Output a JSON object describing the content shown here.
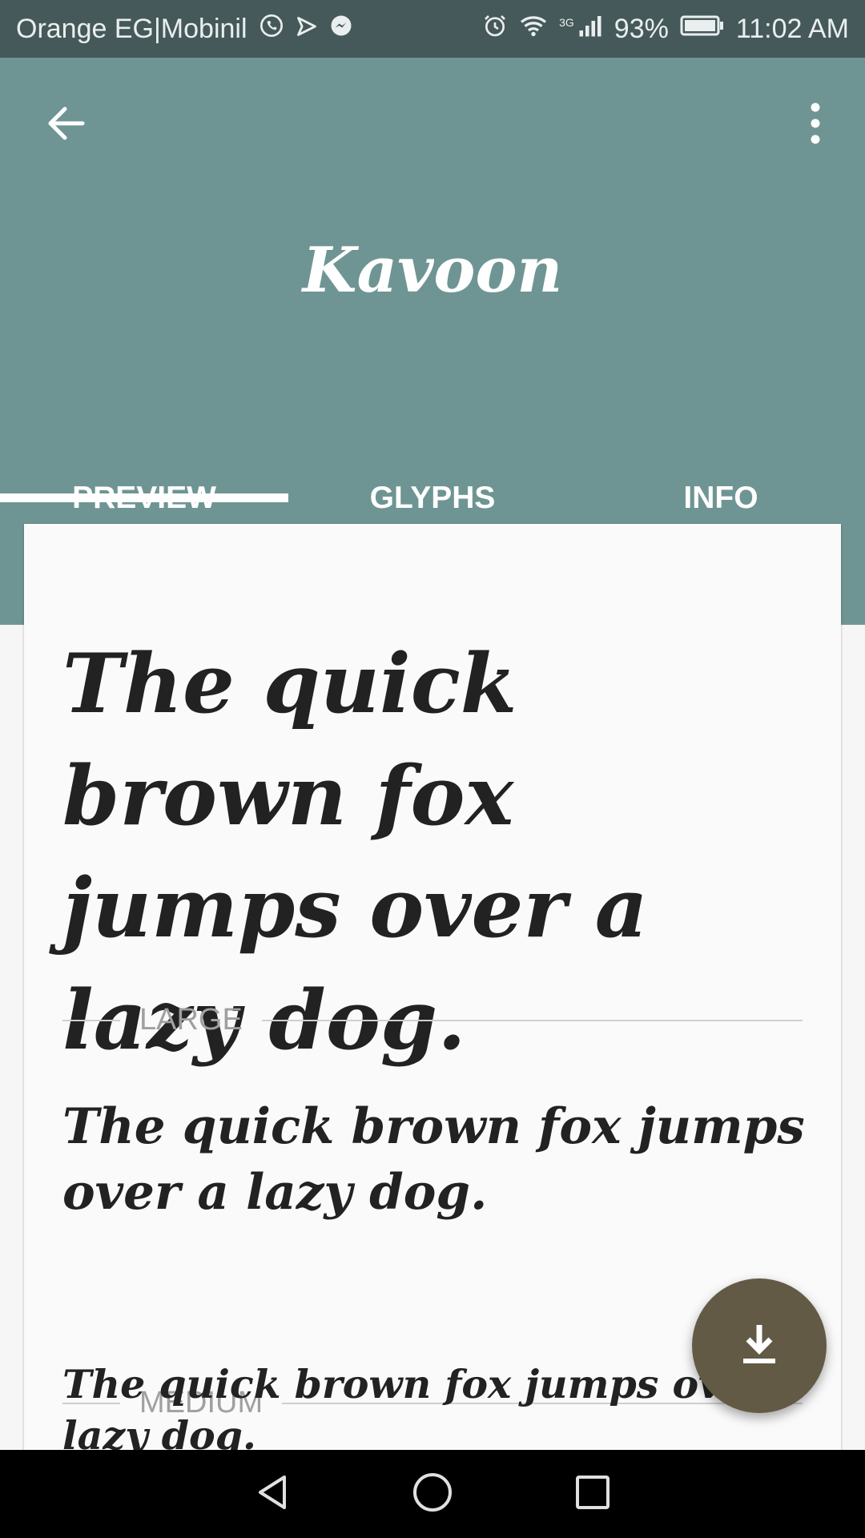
{
  "status_bar": {
    "carrier": "Orange EG|Mobinil",
    "network_type": "3G",
    "battery": "93%",
    "time": "11:02 AM"
  },
  "header": {
    "title": "Kavoon"
  },
  "tabs": [
    {
      "label": "PREVIEW",
      "selected": true
    },
    {
      "label": "GLYPHS",
      "selected": false
    },
    {
      "label": "INFO",
      "selected": false
    }
  ],
  "preview": {
    "sample_xl": "The quick brown fox jumps over a lazy dog.",
    "large_label": "LARGE",
    "sample_large": "The quick brown fox jumps over a lazy dog.",
    "medium_label": "MEDIUM",
    "sample_medium": "The quick brown fox jumps over a lazy dog."
  },
  "colors": {
    "status_bar": "#46595a",
    "header": "#6e9593",
    "fab": "#625a45",
    "card": "#fafafa"
  },
  "icons": {
    "back": "arrow-left-icon",
    "menu": "more-vertical-icon",
    "fab": "download-icon",
    "nav_back": "triangle-back-icon",
    "nav_home": "circle-home-icon",
    "nav_recents": "square-recents-icon"
  }
}
